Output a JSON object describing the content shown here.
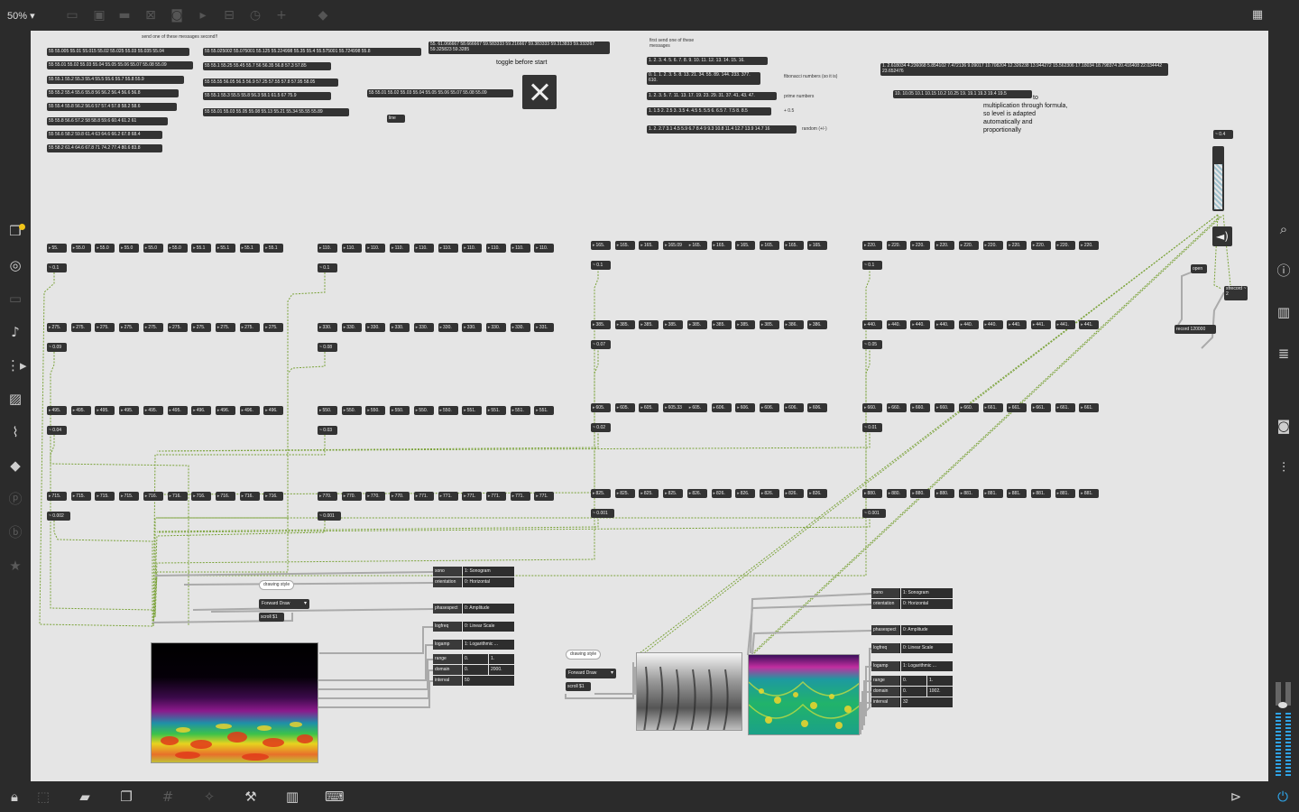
{
  "toolbar": {
    "zoom": "50%",
    "zoom_arrow": "▾"
  },
  "comments": {
    "send_one": "send one of these messages second!!",
    "toggle": "toggle before start",
    "first_send": "first send one of these messages",
    "fibonacci": "fibonacci numbers (so it is)",
    "prime": "prime numbers",
    "plus05": "+ 0.5",
    "random": "random (+/-)",
    "to": "to",
    "multiplication": "multiplication through formula, so level is adapted automatically and proportionally"
  },
  "messages_left": [
    "55 55.005 55.01 55.015 55.02 55.025 55.03 55.035 55.04",
    "55 55.01 55.02 55.03 55.04 55.05 55.06 55.07 55.08 55.09",
    "55 55.1 55.2 55.3 55.4 55.5 55.6 55.7 55.8 55.9",
    "55 55.2 55.4 55.6 55.8 56 56.2 56.4 56.6 56.8",
    "55 55.4 55.8 56.2 56.6 57 57.4 57.8 58.2 58.6",
    "55 55.8 56.6 57.2 58 58.8 59.6 60.4 61.2 61",
    "55 56.6 58.2 59.8 61.4 63 64.6 66.2 67.8 68.4",
    "55 58.2 61.4 64.6 67.8 71 74.2 77.4 80.6 83.8"
  ],
  "messages_mid": [
    "55 55.025002 55.075001 55.125 55.224998 55.35 55.4 55.575001 55.724998 55.8",
    "55 55.1 55.25 55.45 55.7 56 56.35 56.8 57.3 57.85",
    "55 55.55 56.05 56.5 56.9 57.25 57.55 57.8 57.95 58.05",
    "55 55.1 55.3 55.5 55.8 56.3 58.1 61.5 67 75.9",
    "55 55.01 55.03 55.05 55.08 55.13 55.21 55.34 55.55 55.89"
  ],
  "msg_single": "55 55.01 55.02 55.03 55.04 55.05 55.06 55.07 55.08 55.09",
  "msg_top": "55. 61.066667 58.666667 59.583333 59.216667 59.383333 59.313833 59.333267 59.325823 59.3285",
  "line_obj": "line",
  "messages_right": [
    "1. 2. 3. 4. 5. 6. 7. 8. 9. 10. 11. 12. 13. 14. 15. 16.",
    "0. 1. 1. 2. 3. 5. 8. 13. 21. 34. 55. 89. 144. 233. 377. 610.",
    "1. 2. 3. 5. 7. 11. 13. 17. 19. 23. 29. 31. 37. 41. 43. 47.",
    "1. 1.5 2. 2.5 3. 3.5 4. 4.5 5. 5.5 6. 6.5 7. 7.5 8. 8.5",
    "1. 2. 2.7 3.1 4.5 5.9 6.7 8.4 9 9.3 10.8 11.4 12.7 13.9 14.7 16"
  ],
  "msg_far1": "1. 2.618034 4.236068 5.854102 7.472136 9.09017 10.708204 12.326238 13.944272 15.562306 17.18034 18.798374 20.416408 22.034442 23.652476",
  "msg_far2": "10. 10.05 10.1 10.15 10.2 10.25 19. 19.1 19.3 19.4 19.5",
  "groups": [
    {
      "rows": [
        {
          "nums": [
            "55.",
            "55.0",
            "55.0",
            "55.0",
            "55.0",
            "55.0",
            "55.1",
            "55.1",
            "55.1",
            "55.1"
          ],
          "gain": "~ 0.1"
        },
        {
          "nums": [
            "275.",
            "275.",
            "275.",
            "275.",
            "275.",
            "275.",
            "275.",
            "275.",
            "275.",
            "275."
          ],
          "gain": "~ 0.09"
        },
        {
          "nums": [
            "495.",
            "495.",
            "495.",
            "495.",
            "495.",
            "495.",
            "496.",
            "496.",
            "496.",
            "496."
          ],
          "gain": "~ 0.04"
        },
        {
          "nums": [
            "715.",
            "715.",
            "715.",
            "715.",
            "716.",
            "716.",
            "716.",
            "716.",
            "716.",
            "716."
          ],
          "gain": "~ 0.002"
        }
      ]
    },
    {
      "rows": [
        {
          "nums": [
            "110.",
            "110.",
            "110.",
            "110.",
            "110.",
            "110.",
            "110.",
            "110.",
            "110.",
            "110."
          ],
          "gain": "~ 0.1"
        },
        {
          "nums": [
            "330.",
            "330.",
            "330.",
            "330.",
            "330.",
            "330.",
            "330.",
            "330.",
            "330.",
            "331."
          ],
          "gain": "~ 0.08"
        },
        {
          "nums": [
            "550.",
            "550.",
            "550.",
            "550.",
            "550.",
            "550.",
            "551.",
            "551.",
            "551.",
            "551."
          ],
          "gain": "~ 0.03"
        },
        {
          "nums": [
            "770.",
            "770.",
            "770.",
            "770.",
            "771.",
            "771.",
            "771.",
            "771.",
            "771.",
            "771."
          ],
          "gain": "~ 0.001"
        }
      ]
    },
    {
      "rows": [
        {
          "nums": [
            "165.",
            "165.",
            "165.",
            "165.09",
            "165.",
            "165.",
            "165.",
            "165.",
            "165.",
            "165."
          ],
          "gain": "~ 0.1"
        },
        {
          "nums": [
            "385.",
            "385.",
            "385.",
            "385.",
            "385.",
            "385.",
            "385.",
            "385.",
            "386.",
            "386."
          ],
          "gain": "~ 0.07"
        },
        {
          "nums": [
            "605.",
            "605.",
            "605.",
            "605.33",
            "605.",
            "606.",
            "606.",
            "606.",
            "606.",
            "606."
          ],
          "gain": "~ 0.02"
        },
        {
          "nums": [
            "825.",
            "825.",
            "825.",
            "825.",
            "826.",
            "826.",
            "826.",
            "826.",
            "826.",
            "826."
          ],
          "gain": "~ 0.001"
        }
      ]
    },
    {
      "rows": [
        {
          "nums": [
            "220.",
            "220.",
            "220.",
            "220.",
            "220.",
            "220.",
            "220.",
            "220.",
            "220.",
            "220."
          ],
          "gain": "~ 0.1"
        },
        {
          "nums": [
            "440.",
            "440.",
            "440.",
            "440.",
            "440.",
            "440.",
            "440.",
            "441.",
            "441.",
            "441."
          ],
          "gain": "~ 0.05"
        },
        {
          "nums": [
            "660.",
            "660.",
            "660.",
            "660.",
            "660.",
            "661.",
            "661.",
            "661.",
            "661.",
            "661."
          ],
          "gain": "~ 0.01"
        },
        {
          "nums": [
            "880.",
            "880.",
            "880.",
            "880.",
            "881.",
            "881.",
            "881.",
            "881.",
            "881.",
            "881."
          ],
          "gain": "~ 0.001"
        }
      ]
    }
  ],
  "master": {
    "gain": "~ 0.4",
    "open": "open",
    "sfrecord": "sfrecord ~ 2",
    "record": "record 120000",
    "speaker_icon": "speaker-icon"
  },
  "spectro1": {
    "drawing_style": "drawing style",
    "forward": "Forward Draw",
    "scroll": "scroll $1",
    "sono": [
      "sono",
      "1: Sonogram"
    ],
    "orientation": [
      "orientation",
      "0: Horizontal"
    ],
    "phasespect": [
      "phasespect",
      "0: Amplitude"
    ],
    "logfreq": [
      "logfreq",
      "0: Linear Scale"
    ],
    "logamp": [
      "logamp",
      "1: Logarithmic ..."
    ],
    "range": [
      "range",
      "0.",
      "1."
    ],
    "domain": [
      "domain",
      "0.",
      "2000."
    ],
    "interval": [
      "interval",
      "50"
    ]
  },
  "spectro2": {
    "drawing_style": "drawing style",
    "forward": "Forward Draw",
    "scroll": "scroll $1",
    "sono": [
      "sono",
      "1: Sonogram"
    ],
    "orientation": [
      "orientation",
      "0: Horizontal"
    ],
    "phasespect": [
      "phasespect",
      "0: Amplitude"
    ],
    "logfreq": [
      "logfreq",
      "0: Linear Scale"
    ],
    "logamp": [
      "logamp",
      "1: Logarithmic ..."
    ],
    "range": [
      "range",
      "0.",
      "1."
    ],
    "domain": [
      "domain",
      "0.",
      "1002."
    ],
    "interval": [
      "interval",
      "32"
    ]
  },
  "colors": {
    "canvas": "#e5e5e5",
    "chrome": "#2b2b2b",
    "object": "#333333",
    "patchcord": "#7ba33a",
    "accent": "#f0c419"
  }
}
